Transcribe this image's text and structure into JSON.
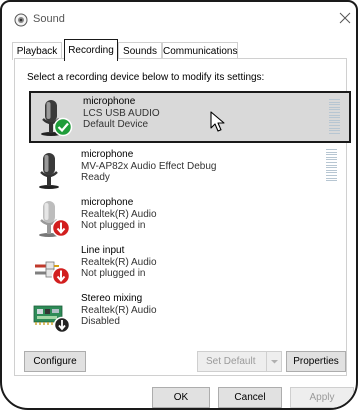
{
  "window": {
    "title": "Sound"
  },
  "tabs": [
    {
      "label": "Playback",
      "active": false
    },
    {
      "label": "Recording",
      "active": true
    },
    {
      "label": "Sounds",
      "active": false
    },
    {
      "label": "Communications",
      "active": false
    }
  ],
  "recording": {
    "instruction": "Select a recording device below to modify its settings:",
    "devices": [
      {
        "name": "microphone",
        "driver": "LCS USB AUDIO",
        "status": "Default Device",
        "icon": "microphone-default-icon",
        "badge": "green-check",
        "selected": true,
        "level": 1.0
      },
      {
        "name": "microphone",
        "driver": "MV-AP82x Audio Effect Debug",
        "status": "Ready",
        "icon": "microphone-icon",
        "badge": "none",
        "selected": false,
        "level": 1.0
      },
      {
        "name": "microphone",
        "driver": "Realtek(R) Audio",
        "status": "Not plugged in",
        "icon": "microphone-unplugged-icon",
        "badge": "red-down-arrow",
        "selected": false
      },
      {
        "name": "Line input",
        "driver": "Realtek(R) Audio",
        "status": "Not plugged in",
        "icon": "line-input-icon",
        "badge": "red-down-arrow",
        "selected": false
      },
      {
        "name": "Stereo mixing",
        "driver": "Realtek(R) Audio",
        "status": "Disabled",
        "icon": "sound-card-icon",
        "badge": "black-down-arrow",
        "selected": false
      }
    ],
    "buttons": {
      "configure": "Configure",
      "set_default": "Set Default",
      "properties": "Properties"
    }
  },
  "footer": {
    "ok": "OK",
    "cancel": "Cancel",
    "apply": "Apply"
  },
  "colors": {
    "selection": "#d9d9d9",
    "check_badge": "#1f9d3a",
    "error_badge": "#d21f1f",
    "level_meter": "#b7c6d2"
  }
}
